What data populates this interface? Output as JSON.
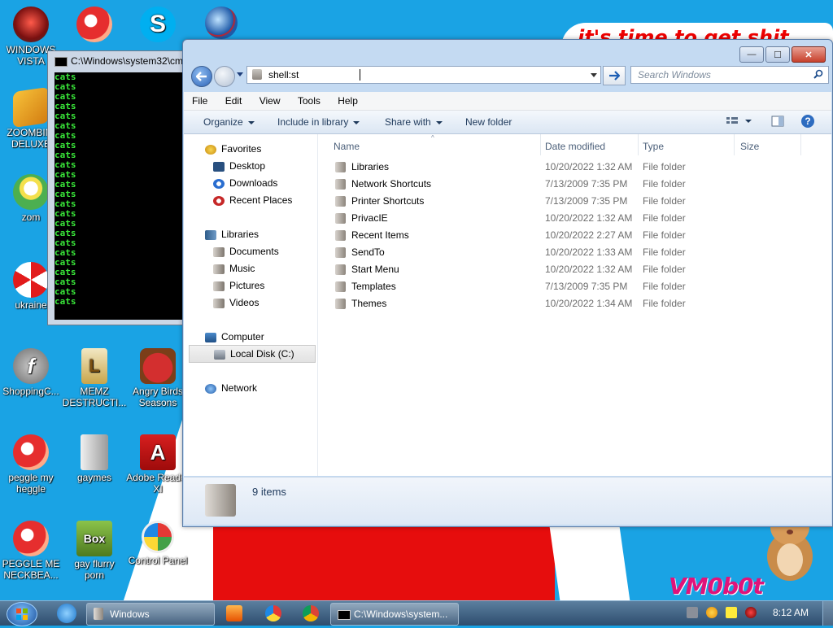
{
  "wallpaper": {
    "banner_text": "it's time to get shit",
    "signature": "VM0b0t",
    "accent_red": "#e60d0d",
    "sky_blue": "#1aa3e4"
  },
  "desktop_icons": [
    {
      "label": "WINDOWS\nVISTA",
      "icon": "vista-orb-icon"
    },
    {
      "label": "",
      "icon": "peggle-icon"
    },
    {
      "label": "",
      "icon": "skype-icon"
    },
    {
      "label": "",
      "icon": "globe-icon"
    },
    {
      "label": "ZOOMBINI\nDELUXE",
      "icon": "zoombini-icon"
    },
    {
      "label": "zom",
      "icon": "plant-icon"
    },
    {
      "label": "ukraine",
      "icon": "radiation-icon"
    },
    {
      "label": "ShoppingC...",
      "icon": "flash-icon"
    },
    {
      "label": "MEMZ\nDESTRUCTI...",
      "icon": "memz-icon"
    },
    {
      "label": "Angry Birds\nSeasons",
      "icon": "angry-birds-icon"
    },
    {
      "label": "peggle my\nheggle",
      "icon": "peggle-icon"
    },
    {
      "label": "gaymes",
      "icon": "games-folder-icon"
    },
    {
      "label": "Adobe Reader\nXI",
      "icon": "adobe-reader-icon"
    },
    {
      "label": "PEGGLE ME\nNECKBEA...",
      "icon": "peggle-icon"
    },
    {
      "label": "gay flurry\nporn",
      "icon": "box-icon"
    },
    {
      "label": "Control Panel",
      "icon": "control-panel-icon"
    }
  ],
  "cmd_window": {
    "title": "C:\\Windows\\system32\\cmd.exe",
    "lines": [
      "cats",
      "cats",
      "cats",
      "cats",
      "cats",
      "cats",
      "cats",
      "cats",
      "cats",
      "cats",
      "cats",
      "cats",
      "cats",
      "cats",
      "cats",
      "cats",
      "cats",
      "cats",
      "cats",
      "cats",
      "cats",
      "cats",
      "cats",
      "cats"
    ]
  },
  "explorer": {
    "caption_buttons": {
      "minimize": "—",
      "maximize": "☐",
      "close": "✕"
    },
    "address": "shell:st",
    "search_placeholder": "Search Windows",
    "menu": [
      "File",
      "Edit",
      "View",
      "Tools",
      "Help"
    ],
    "commands": [
      "Organize",
      "Include in library",
      "Share with",
      "New folder"
    ],
    "nav": {
      "favorites": {
        "label": "Favorites",
        "items": [
          "Desktop",
          "Downloads",
          "Recent Places"
        ]
      },
      "libraries": {
        "label": "Libraries",
        "items": [
          "Documents",
          "Music",
          "Pictures",
          "Videos"
        ]
      },
      "computer": {
        "label": "Computer",
        "items": [
          "Local Disk (C:)"
        ]
      },
      "network": {
        "label": "Network"
      }
    },
    "columns": [
      "Name",
      "Date modified",
      "Type",
      "Size"
    ],
    "files": [
      {
        "name": "Libraries",
        "date": "10/20/2022 1:32 AM",
        "type": "File folder",
        "size": ""
      },
      {
        "name": "Network Shortcuts",
        "date": "7/13/2009 7:35 PM",
        "type": "File folder",
        "size": ""
      },
      {
        "name": "Printer Shortcuts",
        "date": "7/13/2009 7:35 PM",
        "type": "File folder",
        "size": ""
      },
      {
        "name": "PrivacIE",
        "date": "10/20/2022 1:32 AM",
        "type": "File folder",
        "size": ""
      },
      {
        "name": "Recent Items",
        "date": "10/20/2022 2:27 AM",
        "type": "File folder",
        "size": ""
      },
      {
        "name": "SendTo",
        "date": "10/20/2022 1:33 AM",
        "type": "File folder",
        "size": ""
      },
      {
        "name": "Start Menu",
        "date": "10/20/2022 1:32 AM",
        "type": "File folder",
        "size": ""
      },
      {
        "name": "Templates",
        "date": "7/13/2009 7:35 PM",
        "type": "File folder",
        "size": ""
      },
      {
        "name": "Themes",
        "date": "10/20/2022 1:34 AM",
        "type": "File folder",
        "size": ""
      }
    ],
    "status": "9 items"
  },
  "taskbar": {
    "buttons": [
      {
        "label": "Windows",
        "icon": "folder-icon"
      },
      {
        "label": "C:\\Windows\\system...",
        "icon": "cmd-icon"
      }
    ],
    "pinned": [
      "ie-icon",
      "media-player-icon",
      "paint-icon",
      "chrome-icon"
    ],
    "clock": "8:12 AM"
  }
}
